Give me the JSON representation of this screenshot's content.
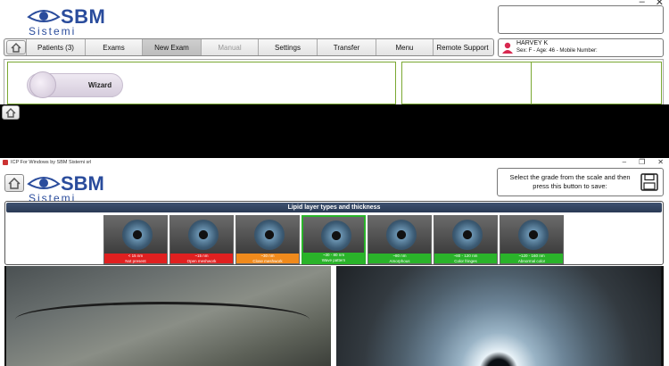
{
  "top": {
    "brand": "SBM",
    "brand_sub": "Sistemi",
    "nav": [
      {
        "label": "Patients (3)",
        "state": "normal"
      },
      {
        "label": "Exams",
        "state": "normal"
      },
      {
        "label": "New Exam",
        "state": "active"
      },
      {
        "label": "Manual",
        "state": "disabled"
      },
      {
        "label": "Settings",
        "state": "normal"
      },
      {
        "label": "Transfer",
        "state": "normal"
      },
      {
        "label": "Menu",
        "state": "normal"
      },
      {
        "label": "Remote Support",
        "state": "normal"
      }
    ],
    "patient": {
      "name": "HARVEY K",
      "info": "Sex: F - Age: 46 - Mobile Number:"
    },
    "wizard_label": "Wizard"
  },
  "bottom": {
    "window_title": "ICP For Windows by SBM Sistemi srl",
    "brand": "SBM",
    "brand_sub": "Sistemi",
    "save_instruction": "Select the grade from the scale and then press this button to save:",
    "scale_title": "Lipid layer types and thickness",
    "grades": [
      {
        "range": "< 15 nm",
        "name": "Not present",
        "color": "#e02020",
        "selected": false
      },
      {
        "range": "~15 nm",
        "name": "Open meshwork",
        "color": "#e02020",
        "selected": false
      },
      {
        "range": "~30 nm",
        "name": "Close meshwork",
        "color": "#f08a1c",
        "selected": false
      },
      {
        "range": "~30 - 80 nm",
        "name": "Wave pattern",
        "color": "#2ab32a",
        "selected": true
      },
      {
        "range": "~80 nm",
        "name": "Amorphous",
        "color": "#2ab32a",
        "selected": false
      },
      {
        "range": "~80 - 120 nm",
        "name": "Color fringes",
        "color": "#2ab32a",
        "selected": false
      },
      {
        "range": "~120 - 160 nm",
        "name": "Abnormal color",
        "color": "#2ab32a",
        "selected": false
      }
    ]
  },
  "colors": {
    "brand_blue": "#2a4c9c",
    "panel_green": "#7aa832",
    "header_navy": "#2a3a55"
  }
}
